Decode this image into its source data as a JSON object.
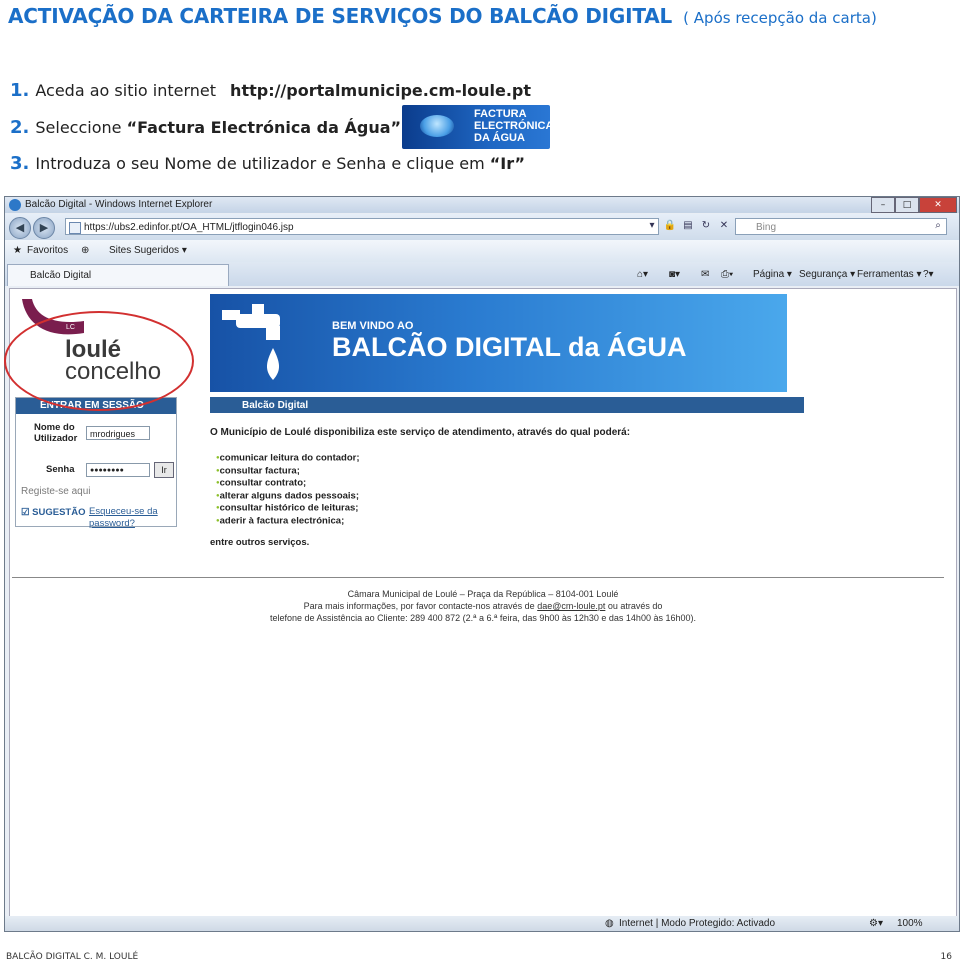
{
  "heading": {
    "main": "ACTIVAÇÃO DA CARTEIRA DE SERVIÇOS DO BALCÃO DIGITAL",
    "sub": "( Após recepção da carta)"
  },
  "steps": [
    {
      "num": "1.",
      "text": "Aceda ao sitio internet",
      "extra": "http://portalmunicipe.cm-loule.pt"
    },
    {
      "num": "2.",
      "text": "Seleccione",
      "extra": "“Factura Electrónica da Água”"
    },
    {
      "num": "3.",
      "text": "Introduza o seu Nome de utilizador e Senha e clique em",
      "extra": "“Ir”"
    }
  ],
  "fact_logo": {
    "lines": [
      "FACTURA",
      "ELECTRÓNICA",
      "DA ÁGUA"
    ]
  },
  "browser": {
    "window_title": "Balcão Digital - Windows Internet Explorer",
    "address": "https://ubs2.edinfor.pt/OA_HTML/jtflogin046.jsp",
    "search_placeholder": "Bing",
    "favorites": "Favoritos",
    "suggested_sites": "Sites Sugeridos ▾",
    "tab_label": "Balcão Digital",
    "cmd_page": "Página ▾",
    "cmd_security": "Segurança ▾",
    "cmd_tools": "Ferramentas ▾",
    "status_zone": "Internet | Modo Protegido: Activado",
    "zoom": "100%"
  },
  "site": {
    "logo_line1": "loulé",
    "logo_line2": "concelho",
    "logo_mark": "LC",
    "banner_small": "BEM VINDO AO",
    "banner_big": "BALCÃO DIGITAL da ÁGUA",
    "login": {
      "header": "ENTRAR EM SESSÃO",
      "user_label": "Nome do Utilizador",
      "user_value": "mrodrigues",
      "pass_label": "Senha",
      "pass_value": "●●●●●●●●",
      "go": "Ir",
      "register": "Registe-se aqui",
      "suggestion": "SUGESTÃO",
      "forgot": "Esqueceu-se da password?"
    },
    "section_header": "Balcão Digital",
    "intro": "O Município de Loulé disponibiliza este serviço de atendimento, através do qual poderá:",
    "services": [
      "comunicar leitura do contador;",
      "consultar factura;",
      "consultar contrato;",
      "alterar alguns dados pessoais;",
      "consultar histórico de leituras;",
      "aderir à factura electrónica;"
    ],
    "others": "entre outros serviços.",
    "footer1": "Câmara Municipal de Loulé – Praça da República – 8104-001 Loulé",
    "footer2a": "Para mais informações, por favor contacte-nos através de",
    "footer2_email": "dae@cm-loule.pt",
    "footer2b": "ou através do",
    "footer3": "telefone de Assistência ao Cliente: 289 400 872 (2.ª a 6.ª feira, das 9h00 às 12h30 e das 14h00 às 16h00)."
  },
  "page_footer": {
    "left": "BALCÃO DIGITAL C. M. LOULÉ",
    "right": "16"
  },
  "colors": {
    "accent": "#1b6fc8",
    "site_blue": "#2a5d96",
    "highlight_circle": "#d23030"
  }
}
